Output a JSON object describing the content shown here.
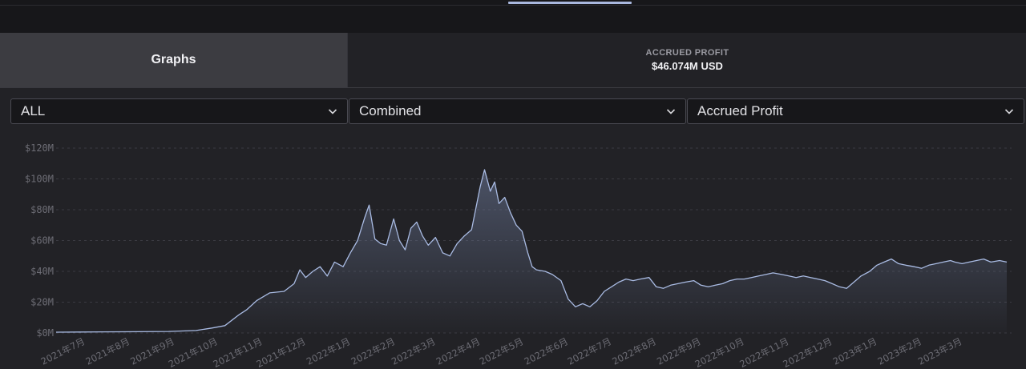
{
  "tabs": {
    "graphs_label": "Graphs",
    "accrued_profit_label": "ACCRUED PROFIT",
    "accrued_profit_value": "$46.074M USD"
  },
  "filters": {
    "range": "ALL",
    "mode": "Combined",
    "metric": "Accrued Profit"
  },
  "colors": {
    "line": "#a9bbe3",
    "fill_top": "#6d7a9a",
    "background": "#222226"
  },
  "chart_data": {
    "type": "area",
    "ylim": [
      0,
      120
    ],
    "y_unit": "M USD",
    "y_ticks": [
      "$0M",
      "$20M",
      "$40M",
      "$60M",
      "$80M",
      "$100M",
      "$120M"
    ],
    "x_ticks": [
      "2021年7月",
      "2021年8月",
      "2021年9月",
      "2021年10月",
      "2021年11月",
      "2021年12月",
      "2022年1月",
      "2022年2月",
      "2022年3月",
      "2022年4月",
      "2022年5月",
      "2022年6月",
      "2022年7月",
      "2022年8月",
      "2022年9月",
      "2022年10月",
      "2022年11月",
      "2022年12月",
      "2023年1月",
      "2023年2月",
      "2023年3月"
    ],
    "grid": "horizontal-dashed",
    "legend": "none",
    "x": [
      "2021-06-15",
      "2021-07-01",
      "2021-08-01",
      "2021-09-01",
      "2021-09-20",
      "2021-10-01",
      "2021-10-10",
      "2021-10-20",
      "2021-10-25",
      "2021-11-01",
      "2021-11-10",
      "2021-11-20",
      "2021-11-27",
      "2021-12-01",
      "2021-12-05",
      "2021-12-10",
      "2021-12-15",
      "2021-12-20",
      "2021-12-25",
      "2021-12-31",
      "2022-01-05",
      "2022-01-10",
      "2022-01-15",
      "2022-01-18",
      "2022-01-22",
      "2022-01-26",
      "2022-01-30",
      "2022-02-04",
      "2022-02-08",
      "2022-02-12",
      "2022-02-16",
      "2022-02-20",
      "2022-02-24",
      "2022-02-28",
      "2022-03-05",
      "2022-03-10",
      "2022-03-15",
      "2022-03-20",
      "2022-03-25",
      "2022-03-30",
      "2022-04-05",
      "2022-04-08",
      "2022-04-12",
      "2022-04-15",
      "2022-04-18",
      "2022-04-22",
      "2022-04-26",
      "2022-04-30",
      "2022-05-04",
      "2022-05-08",
      "2022-05-11",
      "2022-05-14",
      "2022-05-20",
      "2022-05-25",
      "2022-05-31",
      "2022-06-05",
      "2022-06-10",
      "2022-06-15",
      "2022-06-20",
      "2022-06-25",
      "2022-06-30",
      "2022-07-05",
      "2022-07-10",
      "2022-07-15",
      "2022-07-20",
      "2022-07-25",
      "2022-07-31",
      "2022-08-05",
      "2022-08-10",
      "2022-08-15",
      "2022-08-20",
      "2022-08-25",
      "2022-08-31",
      "2022-09-05",
      "2022-09-10",
      "2022-09-15",
      "2022-09-20",
      "2022-09-25",
      "2022-09-30",
      "2022-10-05",
      "2022-10-10",
      "2022-10-15",
      "2022-10-20",
      "2022-10-25",
      "2022-10-31",
      "2022-11-05",
      "2022-11-10",
      "2022-11-15",
      "2022-11-20",
      "2022-11-25",
      "2022-11-30",
      "2022-12-05",
      "2022-12-10",
      "2022-12-15",
      "2022-12-20",
      "2022-12-25",
      "2022-12-31",
      "2023-01-05",
      "2023-01-10",
      "2023-01-15",
      "2023-01-20",
      "2023-01-25",
      "2023-01-31",
      "2023-02-05",
      "2023-02-10",
      "2023-02-15",
      "2023-02-20",
      "2023-02-25",
      "2023-02-28",
      "2023-03-05",
      "2023-03-10",
      "2023-03-15",
      "2023-03-20",
      "2023-03-25",
      "2023-03-31",
      "2023-04-05"
    ],
    "values": [
      0.5,
      0.6,
      0.8,
      1.0,
      1.6,
      3.2,
      4.8,
      12,
      15,
      21,
      26,
      27,
      32,
      41,
      36,
      40,
      43,
      37,
      46,
      43,
      52,
      60,
      75,
      83,
      61,
      58,
      57,
      74,
      60,
      54,
      68,
      72,
      63,
      57,
      62,
      52,
      50,
      58,
      63,
      67,
      95,
      106,
      92,
      98,
      84,
      88,
      78,
      70,
      66,
      52,
      43,
      41,
      40,
      38,
      34,
      22,
      17,
      19,
      17,
      21,
      27,
      30,
      33,
      35,
      34,
      35,
      36,
      30,
      29,
      31,
      32,
      33,
      34,
      31,
      30,
      31,
      32,
      34,
      35,
      35,
      36,
      37,
      38,
      39,
      38,
      37,
      36,
      37,
      36,
      35,
      34,
      32,
      30,
      29,
      33,
      37,
      40,
      44,
      46,
      48,
      45,
      44,
      43,
      42,
      44,
      45,
      46,
      47,
      46,
      45,
      46,
      47,
      48,
      46,
      47,
      46
    ]
  }
}
